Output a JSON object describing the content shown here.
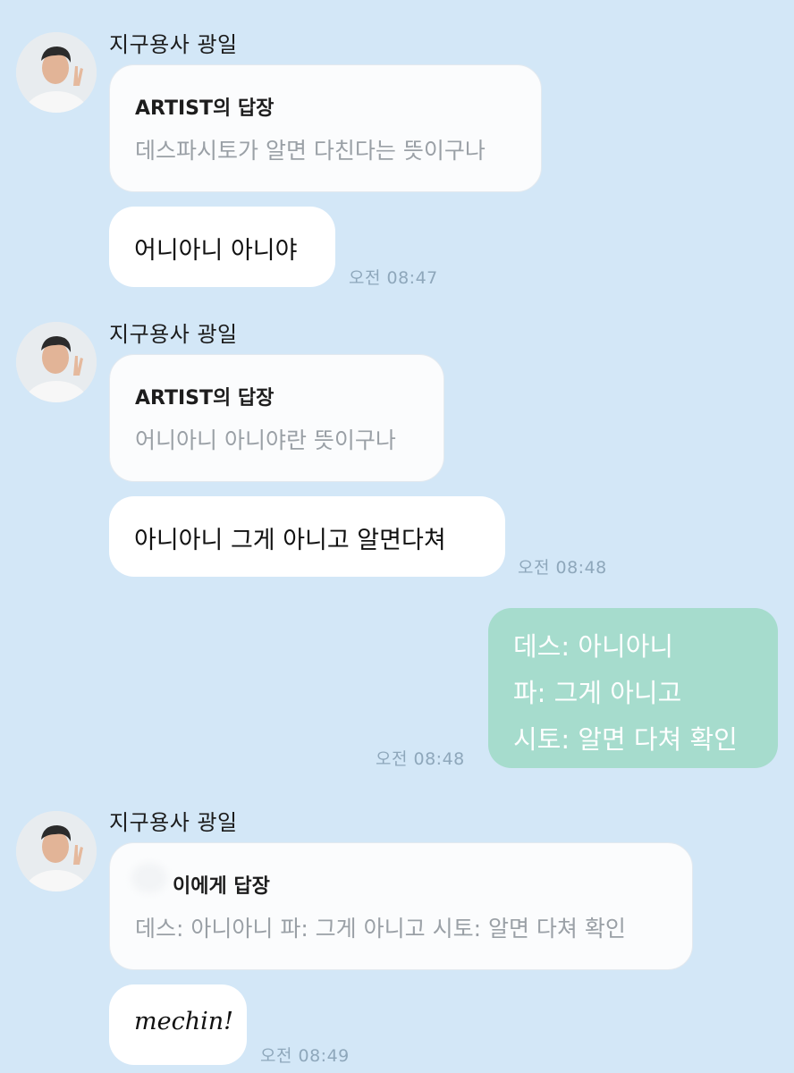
{
  "sender_name": "지구용사 광일",
  "messages": [
    {
      "reply_title": "ARTIST의 답장",
      "reply_quote": "데스파시토가 알면 다친다는 뜻이구나",
      "text": "어니아니 아니야",
      "time": "오전 08:47"
    },
    {
      "reply_title": "ARTIST의 답장",
      "reply_quote": "어니아니 아니야란 뜻이구나",
      "text": "아니아니 그게 아니고 알면다쳐",
      "time": "오전 08:48"
    },
    {
      "reply_title": "이에게 답장",
      "reply_quote": "데스: 아니아니 파: 그게 아니고 시토: 알면 다쳐 확인",
      "text": "mechin!",
      "time": "오전 08:49"
    }
  ],
  "my_message": {
    "lines": [
      "데스: 아니아니",
      "파: 그게 아니고",
      "시토: 알면 다쳐 확인"
    ],
    "time": "오전 08:48"
  },
  "colors": {
    "background": "#d3e7f7",
    "incoming_bubble": "#ffffff",
    "outgoing_bubble": "#a6dccd",
    "timestamp": "#8ea7bb"
  }
}
